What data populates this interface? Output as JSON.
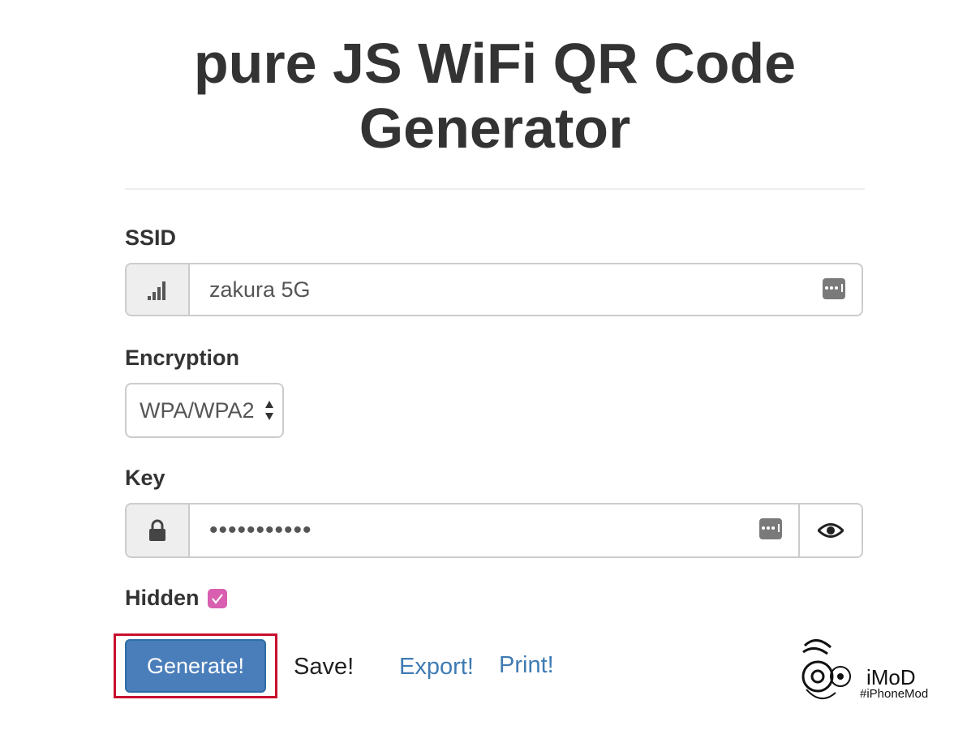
{
  "header": {
    "title_line1": "pure JS WiFi QR Code",
    "title_line2": "Generator"
  },
  "ssid": {
    "label": "SSID",
    "value": "zakura 5G",
    "icon": "signal-icon"
  },
  "encryption": {
    "label": "Encryption",
    "selected": "WPA/WPA2"
  },
  "key": {
    "label": "Key",
    "value": "•••••••••••",
    "icon": "lock-icon",
    "toggle_icon": "eye-icon"
  },
  "hidden": {
    "label": "Hidden",
    "checked": true
  },
  "actions": {
    "generate_label": "Generate!",
    "save_label": "Save!",
    "export_label": "Export!",
    "print_label": "Print!"
  },
  "watermark": {
    "brand": "iMoD",
    "tag": "#iPhoneMod"
  },
  "colors": {
    "primary_button": "#4a7ebb",
    "link": "#3f7bb3",
    "checkbox": "#d95fb0",
    "highlight": "#c8102e"
  }
}
